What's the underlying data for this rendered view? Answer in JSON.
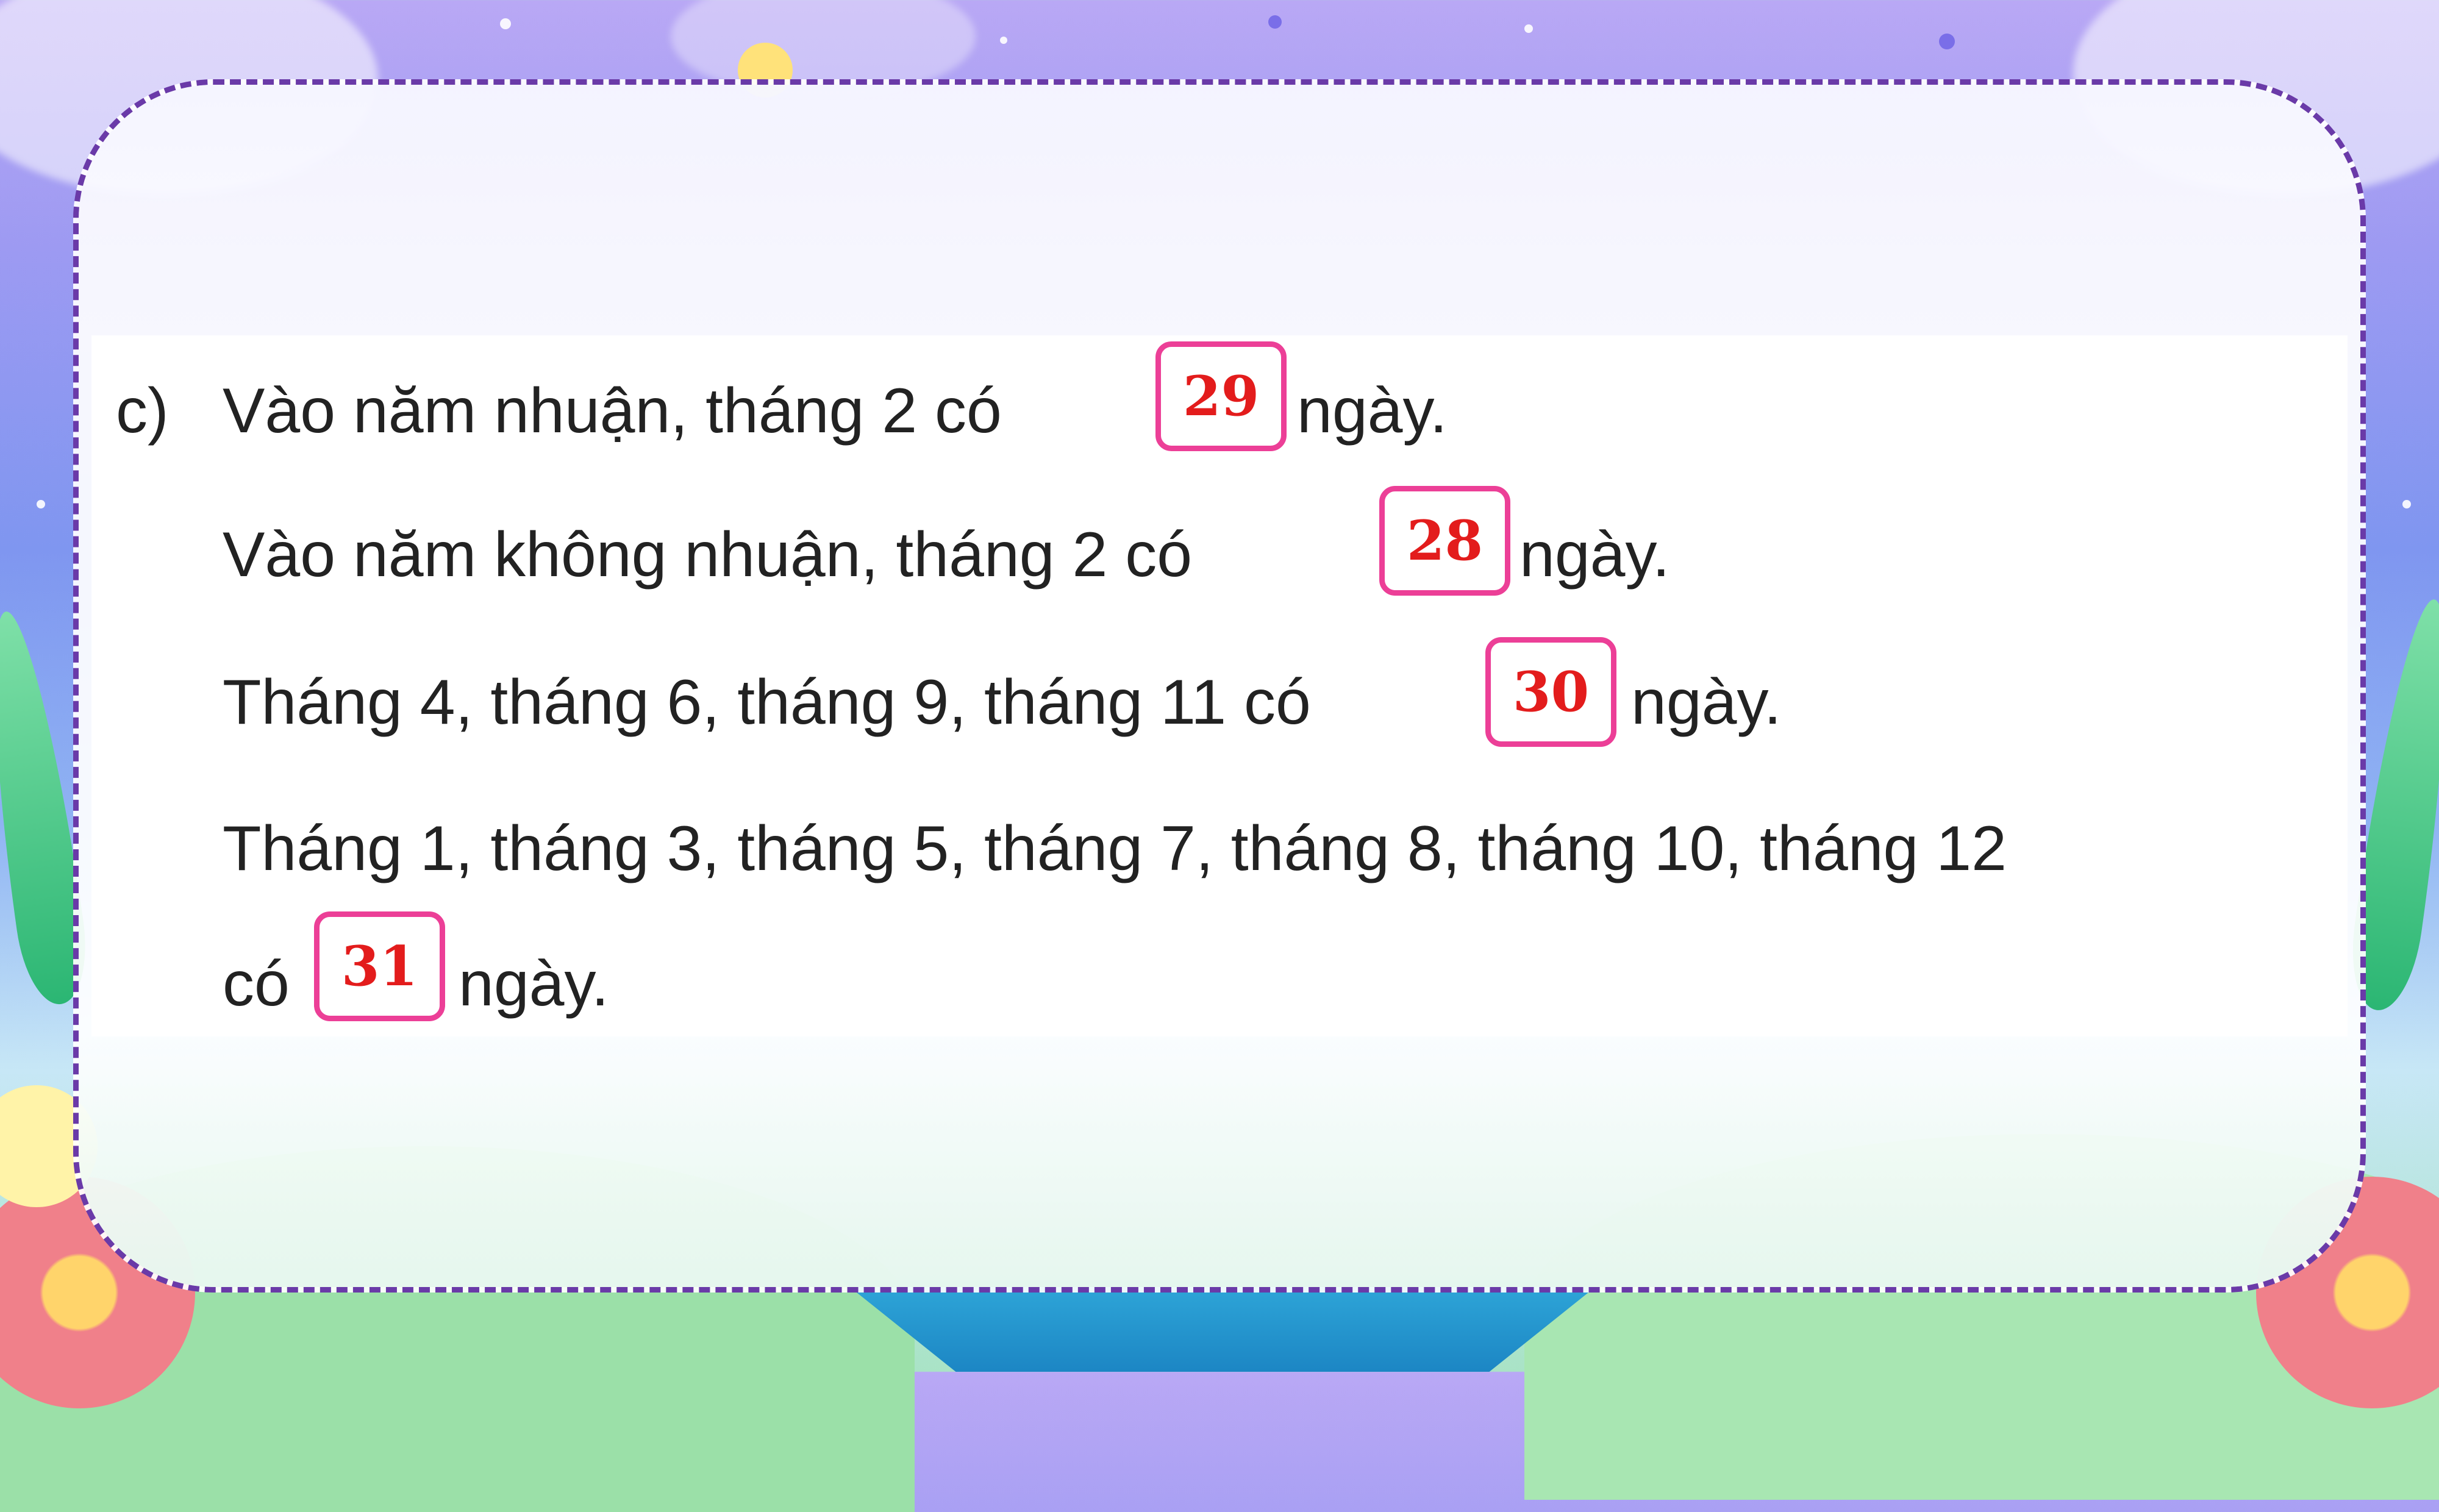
{
  "exercise": {
    "label": "c)",
    "lines": [
      {
        "before": "Vào năm nhuận, tháng 2 có",
        "answer": "29",
        "after": "ngày."
      },
      {
        "before": "Vào năm không nhuận, tháng 2 có",
        "answer": "28",
        "after": "ngày."
      },
      {
        "before": "Tháng 4, tháng 6, tháng 9, tháng 11 có",
        "answer": "30",
        "after": "ngày."
      },
      {
        "before": "Tháng 1, tháng 3, tháng 5, tháng 7, tháng 8, tháng 10, tháng 12",
        "answer": "",
        "after": ""
      },
      {
        "before": "có",
        "answer": "31",
        "after": "ngày."
      }
    ]
  },
  "colors": {
    "border": "#6a3aa8",
    "answer_box": "#ec3f97",
    "answer_text": "#e31c1c"
  }
}
